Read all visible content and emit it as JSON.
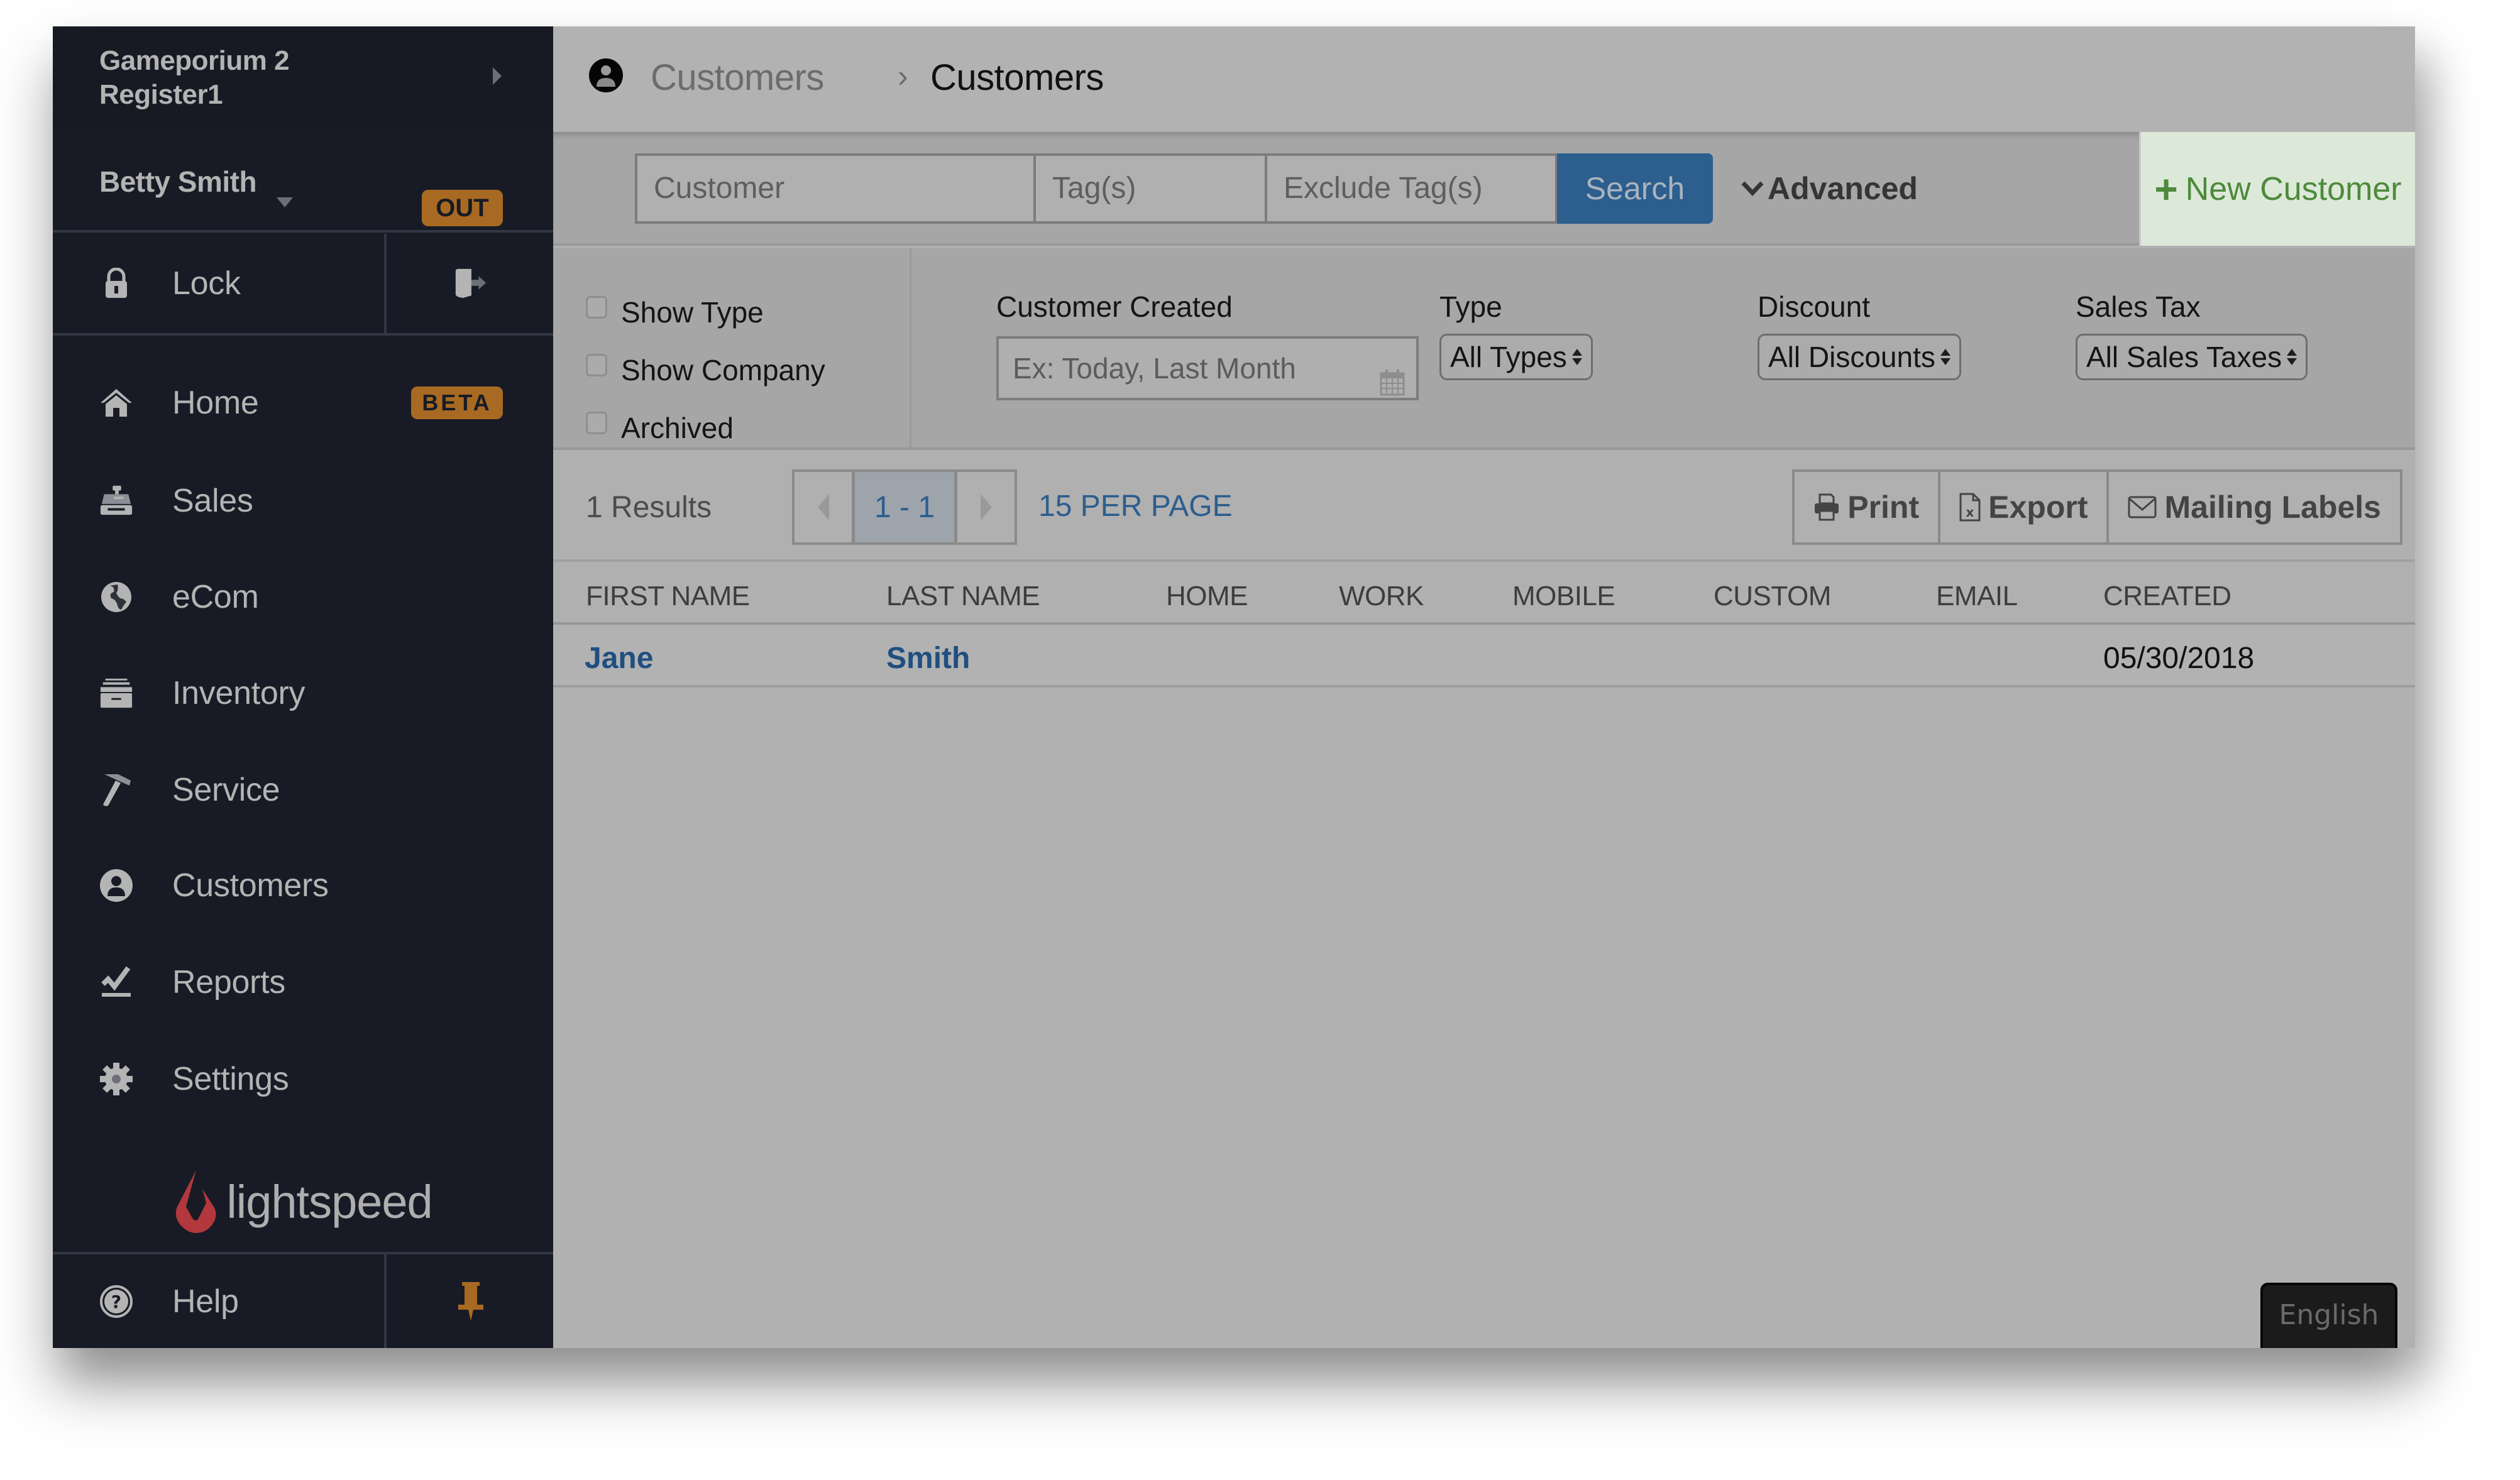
{
  "sidebar": {
    "store_name": "Gameporium 2",
    "register_name": "Register1",
    "user_name": "Betty Smith",
    "user_status_badge": "OUT",
    "lock_label": "Lock",
    "nav_items": [
      {
        "label": "Home",
        "icon": "home-icon",
        "badge": "BETA"
      },
      {
        "label": "Sales",
        "icon": "cash-register-icon"
      },
      {
        "label": "eCom",
        "icon": "globe-icon"
      },
      {
        "label": "Inventory",
        "icon": "archive-icon"
      },
      {
        "label": "Service",
        "icon": "hammer-icon"
      },
      {
        "label": "Customers",
        "icon": "user-circle-icon"
      },
      {
        "label": "Reports",
        "icon": "chart-line-icon"
      },
      {
        "label": "Settings",
        "icon": "gear-icon"
      }
    ],
    "logo_text": "lightspeed",
    "help_label": "Help"
  },
  "header": {
    "breadcrumb_parent": "Customers",
    "breadcrumb_separator": "›",
    "breadcrumb_current": "Customers"
  },
  "search": {
    "customer_placeholder": "Customer",
    "tags_placeholder": "Tag(s)",
    "exclude_tags_placeholder": "Exclude Tag(s)",
    "search_label": "Search",
    "advanced_label": "Advanced",
    "new_customer_label": "New Customer"
  },
  "filters": {
    "checkboxes": [
      {
        "label": "Show Type",
        "checked": false
      },
      {
        "label": "Show Company",
        "checked": false
      },
      {
        "label": "Archived",
        "checked": false
      }
    ],
    "customer_created_label": "Customer Created",
    "customer_created_placeholder": "Ex: Today, Last Month",
    "type_label": "Type",
    "type_value": "All Types",
    "discount_label": "Discount",
    "discount_value": "All Discounts",
    "sales_tax_label": "Sales Tax",
    "sales_tax_value": "All Sales Taxes"
  },
  "results": {
    "count_text": "1 Results",
    "page_range": "1 - 1",
    "per_page": "15 PER PAGE",
    "print_label": "Print",
    "export_label": "Export",
    "mailing_labels_label": "Mailing Labels"
  },
  "table": {
    "columns": [
      "FIRST NAME",
      "LAST NAME",
      "HOME",
      "WORK",
      "MOBILE",
      "CUSTOM",
      "EMAIL",
      "CREATED"
    ],
    "rows": [
      {
        "first_name": "Jane",
        "last_name": "Smith",
        "home": "",
        "work": "",
        "mobile": "",
        "custom": "",
        "email": "",
        "created": "05/30/2018"
      }
    ]
  },
  "language_button": "English",
  "colors": {
    "sidebar_bg": "#181b25",
    "badge_orange": "#a86a22",
    "search_blue": "#2c5e8e",
    "new_customer_green": "#4d8a3b",
    "new_customer_bg": "#dce9d9",
    "link_blue": "#1f4f80",
    "logo_red": "#b2383d"
  }
}
